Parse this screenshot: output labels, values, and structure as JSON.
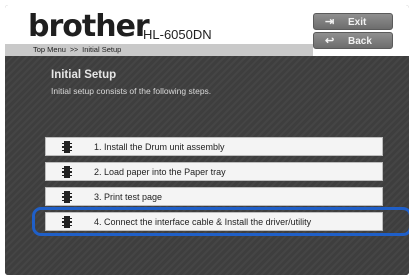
{
  "header": {
    "brand": "brother",
    "model": "HL-6050DN",
    "breadcrumb": {
      "top": "Top Menu",
      "separator": ">>",
      "current": "Initial Setup"
    },
    "exit_label": "Exit",
    "back_label": "Back",
    "exit_icon": "exit-door-icon",
    "back_icon": "back-arrow-icon"
  },
  "main": {
    "title": "Initial Setup",
    "subtitle": "Initial setup consists of the following steps.",
    "steps": [
      {
        "label": "1. Install the Drum unit assembly",
        "icon": "film-icon"
      },
      {
        "label": "2. Load paper into the Paper tray",
        "icon": "film-icon"
      },
      {
        "label": "3. Print test page",
        "icon": "film-icon"
      },
      {
        "label": "4. Connect the interface cable & Install the driver/utility",
        "icon": "film-icon",
        "highlighted": true
      }
    ]
  },
  "colors": {
    "highlight": "#1f5fc8",
    "panel": "#3a3a3a"
  }
}
